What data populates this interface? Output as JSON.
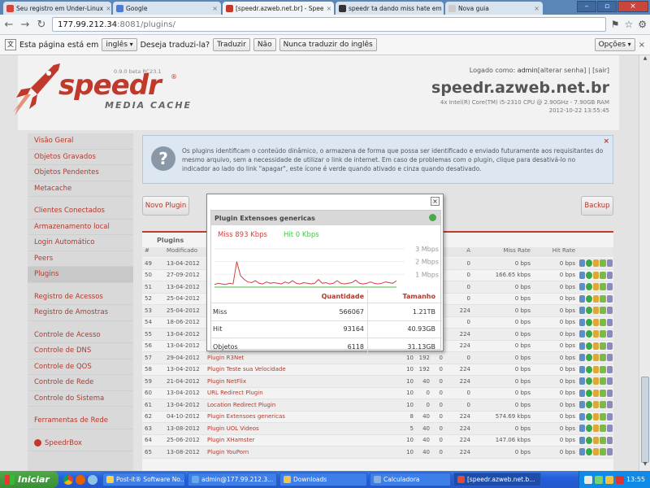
{
  "browser": {
    "tabs": [
      {
        "title": "Seu registro em Under-Linux",
        "fav_color": "#d44638",
        "active": false
      },
      {
        "title": "Google",
        "fav_color": "#4a7cd6",
        "active": false
      },
      {
        "title": "[speedr.azweb.net.br] - Spee",
        "fav_color": "#c0392b",
        "active": true
      },
      {
        "title": "speedr ta dando miss hate em",
        "fav_color": "#333333",
        "active": false
      },
      {
        "title": "Nova guia",
        "fav_color": "#cccccc",
        "active": false
      }
    ],
    "url_host": "177.99.212.34",
    "url_rest": ":8081/plugins/",
    "translate": {
      "prefix": "Esta página está em",
      "language": "inglês",
      "question": "Deseja traduzi-la?",
      "translate_btn": "Traduzir",
      "no_btn": "Não",
      "never_btn": "Nunca traduzir do inglês",
      "options_btn": "Opções"
    }
  },
  "header": {
    "logo": "speedr",
    "logo_sub": "MEDIA CACHE",
    "version": "0.9.0 beta RC23.1",
    "login_label": "Logado como:",
    "login_user": "admin",
    "change_pwd": "[alterar senha]",
    "separator": "|",
    "logout": "[sair]",
    "hostname": "speedr.azweb.net.br",
    "cpu": "4x Intel(R) Core(TM) i5-2310 CPU @ 2.90GHz - 7.90GB RAM",
    "datetime": "2012-10-22 13:55:45"
  },
  "sidebar": [
    [
      "Visão Geral",
      "Objetos Gravados",
      "Objetos Pendentes",
      "Metacache"
    ],
    [
      "Clientes Conectados",
      "Armazenamento local",
      "Login Automático",
      "Peers",
      "Plugins"
    ],
    [
      "Registro de Acessos",
      "Registro de Amostras"
    ],
    [
      "Controle de Acesso",
      "Controle de DNS",
      "Controle de QOS",
      "Controle de Rede",
      "Controle do Sistema"
    ],
    [
      "Ferramentas de Rede"
    ],
    [
      "SpeedrBox"
    ]
  ],
  "info": {
    "text": "Os plugins identificam o conteúdo dinâmico, o armazena de forma que possa ser identificado e enviado futuramente aos requisitantes do mesmo arquivo, sem a necessidade de utilizar o link de internet. Em caso de problemas com o plugin, clique para desativá-lo no indicador ao lado do link \"apagar\", este ícone é verde quando ativado e cinza quando desativado.",
    "close": "×"
  },
  "buttons": {
    "new_plugin": "Novo Plugin",
    "backup": "Backup"
  },
  "table": {
    "title": "Plugins",
    "headers": [
      "#",
      "Modificado",
      "",
      "",
      "",
      "",
      "A",
      "",
      "Miss Rate",
      "Hit Rate"
    ],
    "rows": [
      [
        "49",
        "13-04-2012",
        "",
        "",
        "",
        "",
        "0",
        "",
        "0 bps",
        "0 bps"
      ],
      [
        "50",
        "27-09-2012",
        "",
        "",
        "",
        "",
        "0",
        "",
        "166.65 kbps",
        "0 bps"
      ],
      [
        "51",
        "13-04-2012",
        "",
        "",
        "",
        "",
        "0",
        "",
        "0 bps",
        "0 bps"
      ],
      [
        "52",
        "25-04-2012",
        "",
        "",
        "",
        "",
        "0",
        "",
        "0 bps",
        "0 bps"
      ],
      [
        "53",
        "25-04-2012",
        "",
        "",
        "",
        "",
        "224",
        "",
        "0 bps",
        "0 bps"
      ],
      [
        "54",
        "18-06-2012",
        "",
        "",
        "",
        "",
        "0",
        "",
        "0 bps",
        "0 bps"
      ],
      [
        "55",
        "13-04-2012",
        "",
        "",
        "",
        "",
        "224",
        "",
        "0 bps",
        "0 bps"
      ],
      [
        "56",
        "13-04-2012",
        "",
        "",
        "",
        "",
        "224",
        "",
        "0 bps",
        "0 bps"
      ],
      [
        "57",
        "29-04-2012",
        "Plugin R3Net",
        "10",
        "192",
        "0",
        "0",
        "",
        "0 bps",
        "0 bps"
      ],
      [
        "58",
        "13-04-2012",
        "Plugin Teste sua Velocidade",
        "10",
        "192",
        "0",
        "224",
        "",
        "0 bps",
        "0 bps"
      ],
      [
        "59",
        "21-04-2012",
        "Plugin NetFlix",
        "10",
        "40",
        "0",
        "224",
        "",
        "0 bps",
        "0 bps"
      ],
      [
        "60",
        "13-04-2012",
        "URL Redirect Plugin",
        "10",
        "0",
        "0",
        "0",
        "",
        "0 bps",
        "0 bps"
      ],
      [
        "61",
        "13-04-2012",
        "Location Redirect Plugin",
        "10",
        "0",
        "0",
        "0",
        "",
        "0 bps",
        "0 bps"
      ],
      [
        "62",
        "04-10-2012",
        "Plugin Extensoes genericas",
        "8",
        "40",
        "0",
        "224",
        "",
        "574.69 kbps",
        "0 bps"
      ],
      [
        "63",
        "13-08-2012",
        "Plugin UOL Videos",
        "5",
        "40",
        "0",
        "224",
        "",
        "0 bps",
        "0 bps"
      ],
      [
        "64",
        "25-06-2012",
        "Plugin XHamster",
        "10",
        "40",
        "0",
        "224",
        "",
        "147.06 kbps",
        "0 bps"
      ],
      [
        "65",
        "13-08-2012",
        "Plugin YouPorn",
        "10",
        "40",
        "0",
        "224",
        "",
        "0 bps",
        "0 bps"
      ]
    ]
  },
  "popup": {
    "close": "×",
    "title": "Plugin Extensoes genericas",
    "miss_label": "Miss 893 Kbps",
    "hit_label": "Hit 0 Kbps",
    "y_ticks": [
      "3 Mbps",
      "2 Mbps",
      "1 Mbps"
    ],
    "col_qty": "Quantidade",
    "col_size": "Tamanho",
    "stats": [
      {
        "label": "Miss",
        "qty": "566067",
        "size": "1.21TB"
      },
      {
        "label": "Hit",
        "qty": "93164",
        "size": "40.93GB"
      },
      {
        "label": "Objetos",
        "qty": "6118",
        "size": "31.13GB"
      }
    ],
    "colors": {
      "miss": "#d04040",
      "hit": "#4cbf4c"
    }
  },
  "chart_data": {
    "type": "line",
    "ylim": [
      0,
      3.5
    ],
    "y_ticks": [
      3,
      2,
      1
    ],
    "series": [
      {
        "name": "Miss",
        "values": [
          0.2,
          0.3,
          0.25,
          0.2,
          0.3,
          0.25,
          2.0,
          0.9,
          0.6,
          0.4,
          0.35,
          0.5,
          0.3,
          0.25,
          0.4,
          0.3,
          0.35,
          0.3,
          0.25,
          0.4,
          0.3,
          0.5,
          0.3,
          0.25,
          0.35,
          0.3,
          0.25,
          0.3,
          0.6,
          0.3,
          0.35,
          0.25,
          0.3,
          0.5,
          0.3,
          0.25,
          0.3,
          0.35,
          0.55,
          0.3,
          0.25,
          0.3,
          0.4,
          0.3,
          0.25,
          0.3,
          0.4,
          0.35,
          0.3,
          0.5
        ]
      },
      {
        "name": "Hit",
        "values": [
          0,
          0,
          0,
          0,
          0,
          0,
          0,
          0,
          0,
          0,
          0,
          0,
          0,
          0,
          0,
          0,
          0,
          0,
          0,
          0,
          0,
          0,
          0,
          0,
          0,
          0,
          0,
          0,
          0,
          0,
          0,
          0,
          0,
          0,
          0,
          0,
          0,
          0,
          0,
          0,
          0,
          0,
          0,
          0,
          0,
          0,
          0,
          0,
          0,
          0
        ]
      }
    ]
  },
  "taskbar": {
    "start": "Iniciar",
    "tasks": [
      "Post-it® Software No...",
      "admin@177.99.212.3...",
      "Downloads",
      "Calculadora",
      "[speedr.azweb.net.b..."
    ],
    "clock": "13:55"
  }
}
